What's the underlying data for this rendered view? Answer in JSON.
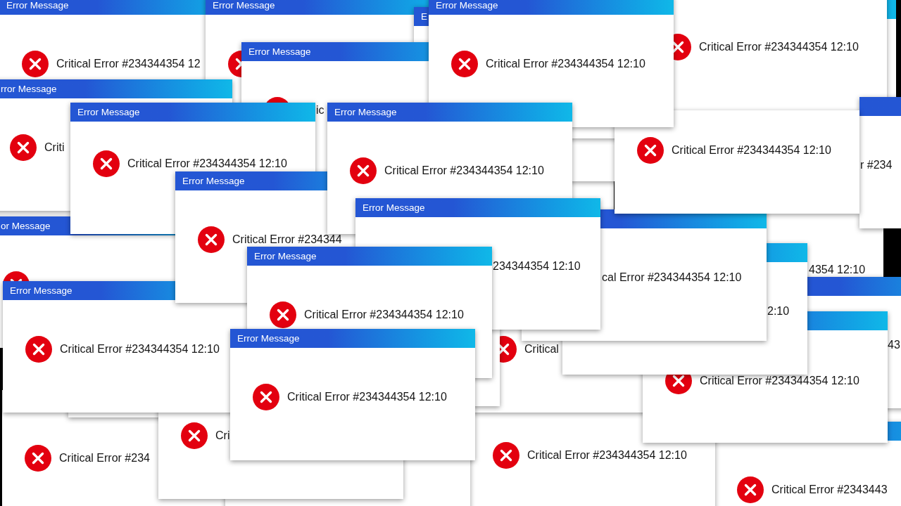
{
  "dialogs": [
    {
      "title": "Error Message",
      "message": "Critical Error #234344354 12"
    },
    {
      "title": "Error Message"
    },
    {
      "title": "Error Message",
      "message": "Critical Error #234344354 12:10"
    },
    {
      "message": "Critical Error #234344354 12:10"
    },
    {
      "title": "E"
    },
    {
      "title": "Error Message",
      "message": "ic"
    },
    {
      "title": "rror Message",
      "message": "Criti"
    },
    {
      "title": "Error Message",
      "message": "Critical Error #234344354 12:10"
    },
    {
      "title": "Error Message",
      "message": "Critical Error #234344354 12:10"
    },
    {
      "message": "Critical Error #234344354 12:10"
    },
    {
      "message": "r #234"
    },
    {
      "title": "Error Message",
      "message": "Critical Error #234344"
    },
    {
      "title": "Error Message",
      "message": "234344354 12:10"
    },
    {
      "message": "4354 12:10"
    },
    {
      "title": "or Message"
    },
    {
      "message": "cal Error #234344354 12:10"
    },
    {
      "title": "Error Message",
      "message": "Critical Error #234344354 12:10"
    },
    {
      "title": "Error Message",
      "message": "Critical Error #234344354 12:10"
    },
    {
      "message": "2:10"
    },
    {
      "message": "43"
    },
    {
      "message": "Critical"
    },
    {
      "title": "Error Message",
      "message": "Critical Error #234344354 12:10"
    },
    {
      "message": "Critical Error #234344354 12:10"
    },
    {
      "message": "Cri"
    },
    {
      "message": "Critical Error #234"
    },
    {
      "message": "Critical Error #234344354 12:10"
    },
    {
      "message": "Critical Error #2343443"
    }
  ]
}
